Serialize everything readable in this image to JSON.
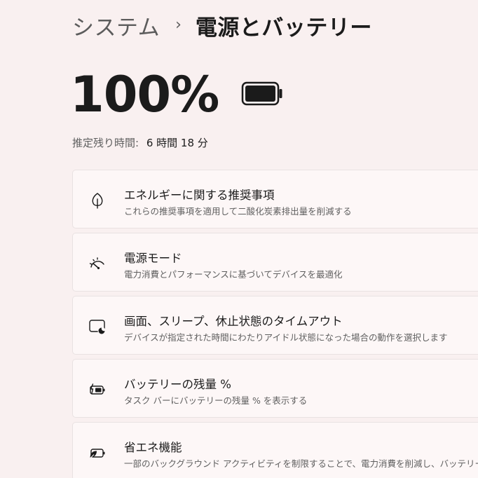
{
  "breadcrumb": {
    "parent": "システム",
    "separator": "›",
    "current": "電源とバッテリー"
  },
  "battery": {
    "percent_text": "100%",
    "level": 1.0,
    "icon": "battery-full-icon"
  },
  "remaining": {
    "label": "推定残り時間:",
    "value": "6 時間 18 分"
  },
  "cards": [
    {
      "icon": "leaf-icon",
      "title": "エネルギーに関する推奨事項",
      "description": "これらの推奨事項を適用して二酸化炭素排出量を削減する"
    },
    {
      "icon": "power-mode-gauge-icon",
      "title": "電源モード",
      "description": "電力消費とパフォーマンスに基づいてデバイスを最適化"
    },
    {
      "icon": "screen-sleep-icon",
      "title": "画面、スリープ、休止状態のタイムアウト",
      "description": "デバイスが指定された時間にわたりアイドル状態になった場合の動作を選択します"
    },
    {
      "icon": "battery-percentage-icon",
      "title": "バッテリーの残量 %",
      "description": "タスク バーにバッテリーの残量 % を表示する"
    },
    {
      "icon": "battery-saver-icon",
      "title": "省エネ機能",
      "description": "一部のバックグラウンド アクティビティを制限することで、電力消費を削減し、バッテリーの寿"
    }
  ]
}
